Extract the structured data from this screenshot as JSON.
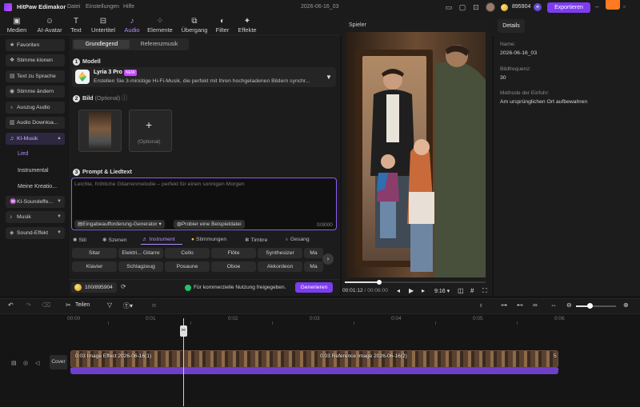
{
  "app": {
    "title": "HitPaw Edimakor",
    "menu": [
      "Datei",
      "Einstellungen",
      "Hilfe"
    ],
    "project": "2026-06-16_03",
    "credits": "895904",
    "export_label": "Exportieren"
  },
  "tabs": [
    {
      "label": "Medien",
      "icon": "folder-icon"
    },
    {
      "label": "AI-Avatar",
      "icon": "avatar-icon"
    },
    {
      "label": "Text",
      "icon": "text-icon"
    },
    {
      "label": "Untertitel",
      "icon": "subtitle-icon"
    },
    {
      "label": "Audio",
      "icon": "music-note-icon"
    },
    {
      "label": "Elemente",
      "icon": "elements-icon"
    },
    {
      "label": "Übergang",
      "icon": "transition-icon"
    },
    {
      "label": "Filter",
      "icon": "filter-icon"
    },
    {
      "label": "Effekte",
      "icon": "effects-icon"
    }
  ],
  "sidebar": {
    "items": [
      {
        "label": "Favoriten",
        "icon": "star-icon"
      },
      {
        "label": "Stimme klonen",
        "icon": "clone-icon"
      },
      {
        "label": "Text zu Sprache",
        "icon": "text-to-speech-icon"
      },
      {
        "label": "Stimme ändern",
        "icon": "voice-change-icon"
      },
      {
        "label": "Auszug Audio",
        "icon": "microphone-icon"
      },
      {
        "label": "Audio Downloa...",
        "icon": "download-icon"
      },
      {
        "label": "KI-Musik",
        "icon": "ai-music-icon"
      }
    ],
    "sub": [
      "Lied",
      "Instrumental",
      "Meine Kreatio..."
    ],
    "items2": [
      {
        "label": "KI-Soundeffe...",
        "icon": "sound-fx-icon"
      },
      {
        "label": "Musik",
        "icon": "music-icon"
      },
      {
        "label": "Sound-Effekt",
        "icon": "speaker-icon"
      }
    ]
  },
  "panel": {
    "seg": [
      "Grundlegend",
      "Referenzmusik"
    ],
    "model_title": "Modell",
    "model_name": "Lyria 3 Pro",
    "model_badge": "NEW",
    "model_desc": "Erstellen Sie 3-minütige Hi-Fi-Musik, die perfekt mit Ihren hochgeladenen Bildern synchr...",
    "image_title": "Bild",
    "image_optional": "(Optional)",
    "add_optional": "(Optional)",
    "prompt_title": "Prompt & Liedtext",
    "prompt_placeholder": "Leichte, fröhliche Gitarrenmelodie – perfekt für einen sonnigen Morgen",
    "gen_btn": "Eingabeaufforderung-Generator",
    "example_btn": "Probier eine Beispieldatei",
    "count": "0/3000",
    "categories": [
      "Stil",
      "Szenen",
      "Instrument",
      "Stimmungen",
      "Timbre",
      "Gesang"
    ],
    "chips_row1": [
      "Sitar",
      "Elektri... Gitarre",
      "Cello",
      "Flöte",
      "Synthesizer",
      "Ma"
    ],
    "chips_row2": [
      "Klavier",
      "Schlagzeug",
      "Posaune",
      "Oboe",
      "Akkordeon",
      "Ma"
    ],
    "credits": "100/895904",
    "commercial": "Für kommerzielle Nutzung freigegeben.",
    "generate": "Generieren"
  },
  "player": {
    "title": "Spieler",
    "time_current": "00:01:12",
    "time_total": "00:06:00",
    "ratio": "9:16",
    "progress": 0.25
  },
  "details": {
    "tab": "Details",
    "fields": [
      {
        "label": "Name:",
        "value": "2026-06-16_03"
      },
      {
        "label": "Bildfrequenz:",
        "value": "30"
      },
      {
        "label": "Methode der Einfuhr:",
        "value": "Am ursprünglichen Ort aufbewahren"
      }
    ]
  },
  "timeline": {
    "split_label": "Teilen",
    "ruler": [
      "00:00",
      "0:01",
      "0:02",
      "0:03",
      "0:04",
      "0:05",
      "0:06"
    ],
    "cover": "Cover",
    "clip1": "0:03 Image Effect 2026-06-16(1)",
    "clip2": "0:03 Reference Image 2026-06-16(2)",
    "clip3": "5"
  }
}
